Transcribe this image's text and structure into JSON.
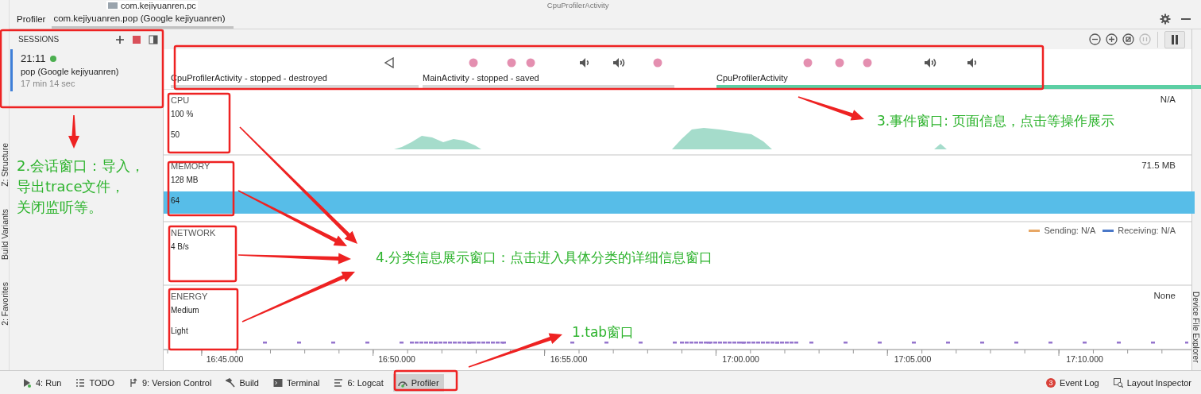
{
  "top_strip": {
    "project_item": "com.kejiyuanren.pc",
    "editor_tab": "CpuProfilerActivity"
  },
  "tool_window": {
    "title": "Profiler",
    "tabs": [
      {
        "label": "com.kejiyuanren.pop (Google kejiyuanren)",
        "selected": true
      }
    ]
  },
  "left_stripe": [
    "Z: Structure",
    "Build Variants",
    "2: Favorites"
  ],
  "right_stripe": [
    "Device File Explorer"
  ],
  "sessions": {
    "title": "SESSIONS",
    "items": [
      {
        "time": "21:11",
        "live": true,
        "name": "pop (Google kejiyuanren)",
        "duration": "17 min 14 sec",
        "selected": true
      }
    ]
  },
  "events": {
    "markers": [
      {
        "kind": "back"
      },
      {
        "kind": "touch"
      },
      {
        "kind": "touch"
      },
      {
        "kind": "touch"
      },
      {
        "kind": "volume-down"
      },
      {
        "kind": "volume-up"
      },
      {
        "kind": "touch"
      },
      {
        "kind": "touch"
      },
      {
        "kind": "touch"
      },
      {
        "kind": "touch"
      },
      {
        "kind": "volume-up"
      },
      {
        "kind": "volume-down"
      }
    ],
    "activities": [
      {
        "label": "CpuProfilerActivity - stopped - destroyed",
        "active": false
      },
      {
        "label": "MainActivity - stopped - saved",
        "active": false
      },
      {
        "label": "CpuProfilerActivity",
        "active": true
      }
    ]
  },
  "monitors": [
    {
      "kind": "cpu",
      "title": "CPU",
      "axis": [
        "100 %",
        "50"
      ],
      "reading": "N/A"
    },
    {
      "kind": "memory",
      "title": "MEMORY",
      "axis": [
        "128 MB",
        "64"
      ],
      "reading": "71.5 MB"
    },
    {
      "kind": "network",
      "title": "NETWORK",
      "axis": [
        "4 B/s"
      ],
      "legend": [
        {
          "label": "Sending: N/A",
          "color": "#e8a765"
        },
        {
          "label": "Receiving: N/A",
          "color": "#4a78c8"
        }
      ]
    },
    {
      "kind": "energy",
      "title": "ENERGY",
      "axis": [
        "Medium",
        "Light"
      ],
      "reading": "None"
    }
  ],
  "time_axis": [
    "16:45.000",
    "16:50.000",
    "16:55.000",
    "17:00.000",
    "17:05.000",
    "17:10.000"
  ],
  "bottom_bar": {
    "left": [
      {
        "kind": "run",
        "label": "4: Run",
        "selected": false
      },
      {
        "kind": "todo",
        "label": "TODO",
        "selected": false
      },
      {
        "kind": "vcs",
        "label": "9: Version Control",
        "selected": false
      },
      {
        "kind": "build",
        "label": "Build",
        "selected": false
      },
      {
        "kind": "terminal",
        "label": "Terminal",
        "selected": false
      },
      {
        "kind": "logcat",
        "label": "6: Logcat",
        "selected": false
      },
      {
        "kind": "profiler",
        "label": "Profiler",
        "selected": true
      }
    ],
    "right": [
      {
        "kind": "event-log",
        "label": "Event Log",
        "badge": "3"
      },
      {
        "kind": "layout-inspector",
        "label": "Layout Inspector"
      }
    ]
  },
  "annotations": [
    {
      "kind": "sessions",
      "lines": [
        "2.会话窗口：导入，",
        "导出trace文件，",
        "关闭监听等。"
      ]
    },
    {
      "kind": "events",
      "lines": [
        "3.事件窗口: 页面信息，点击等操作展示"
      ]
    },
    {
      "kind": "monitors",
      "lines": [
        "4.分类信息展示窗口：点击进入具体分类的详细信息窗口"
      ]
    },
    {
      "kind": "tabs",
      "lines": [
        "1.tab窗口"
      ]
    }
  ]
}
